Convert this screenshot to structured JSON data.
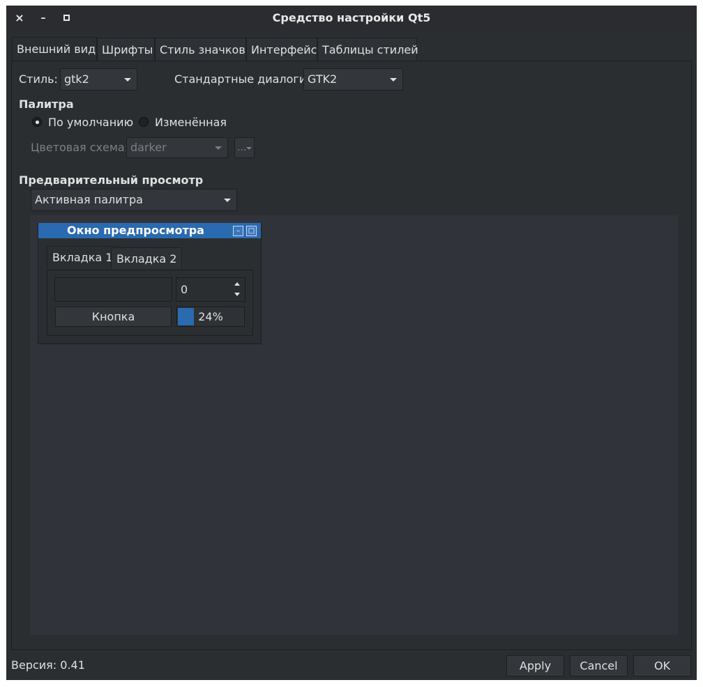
{
  "window": {
    "title": "Средство настройки Qt5",
    "controls": {
      "close": "×",
      "minimize": "–",
      "maximize": "□"
    }
  },
  "tabs": [
    {
      "label": "Внешний вид",
      "active": true
    },
    {
      "label": "Шрифты",
      "active": false
    },
    {
      "label": "Стиль значков",
      "active": false
    },
    {
      "label": "Интерфейс",
      "active": false
    },
    {
      "label": "Таблицы стилей",
      "active": false
    }
  ],
  "appearance": {
    "style_label": "Стиль:",
    "style_value": "gtk2",
    "dialogs_label": "Стандартные диалоги:",
    "dialogs_value": "GTK2",
    "palette_heading": "Палитра",
    "palette_default": "По умолчанию",
    "palette_modified": "Изменённая",
    "palette_selected": "default",
    "color_scheme_label": "Цветовая схема:",
    "color_scheme_value": "darker",
    "color_scheme_more": "...",
    "preview_heading": "Предварительный просмотр",
    "preview_palette_value": "Активная палитра"
  },
  "preview_window": {
    "title": "Окно предпросмотра",
    "tabs": [
      {
        "label": "Вкладка 1",
        "active": true
      },
      {
        "label": "Вкладка 2",
        "active": false
      }
    ],
    "text_input_value": "",
    "spinbox_value": "0",
    "button_label": "Кнопка",
    "progress_text": "24%",
    "progress_value": 0.24,
    "accent_color": "#2a6ab0"
  },
  "footer": {
    "version": "Версия: 0.41",
    "apply": "Apply",
    "cancel": "Cancel",
    "ok": "OK"
  }
}
